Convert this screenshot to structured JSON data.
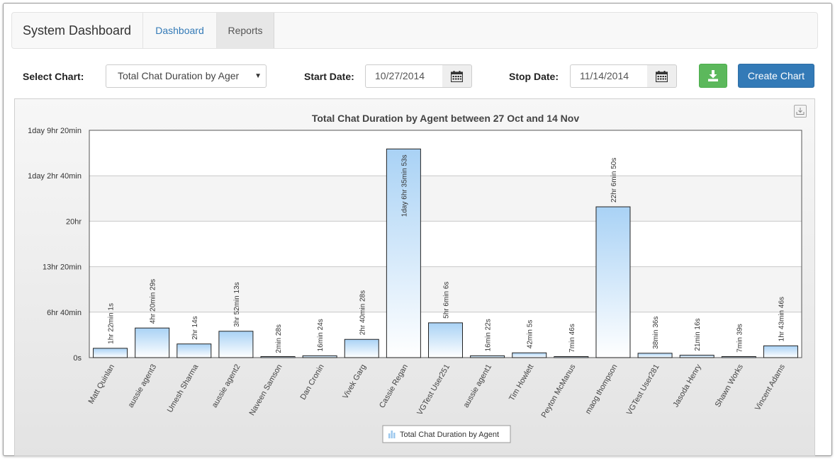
{
  "navbar": {
    "brand": "System Dashboard",
    "tabs": [
      {
        "label": "Dashboard",
        "active": false
      },
      {
        "label": "Reports",
        "active": true
      }
    ]
  },
  "controls": {
    "select_chart_label": "Select Chart:",
    "select_chart_value": "Total Chat Duration by Ager",
    "start_date_label": "Start Date:",
    "start_date_value": "10/27/2014",
    "stop_date_label": "Stop Date:",
    "stop_date_value": "11/14/2014",
    "download_icon": "download-icon",
    "create_chart_label": "Create Chart",
    "calendar_icon": "calendar-icon"
  },
  "colors": {
    "bar_top": "#a9d2f5",
    "bar_bottom": "#ffffff",
    "create_button": "#337ab7",
    "download_button": "#5cb85c",
    "active_tab_text": "#337ab7"
  },
  "chart_data": {
    "type": "bar",
    "title": "Total Chat Duration by Agent between 27 Oct and 14 Nov",
    "legend": {
      "position": "bottom-center",
      "entries": [
        "Total Chat Duration by Agent"
      ]
    },
    "grid": true,
    "y_unit": "seconds",
    "ylim": [
      0,
      120000
    ],
    "y_ticks": [
      {
        "value": 0,
        "label": "0s"
      },
      {
        "value": 24000,
        "label": "6hr 40min"
      },
      {
        "value": 48000,
        "label": "13hr 20min"
      },
      {
        "value": 72000,
        "label": "20hr"
      },
      {
        "value": 96000,
        "label": "1day 2hr 40min"
      },
      {
        "value": 120000,
        "label": "1day 9hr 20min"
      }
    ],
    "categories": [
      "Matt Quinlan",
      "aussie agent3",
      "Umesh Sharma",
      "aussie agent2",
      "Naveen Samson",
      "Dan Cronin",
      "Vivek Garg",
      "Cassie Regan",
      "VGTest User251",
      "aussie agent1",
      "Tim Howlett",
      "Peyton McManus",
      "maog thompson",
      "VGTest User281",
      "Jasoda Henry",
      "Shawn Works",
      "Vincent Adams"
    ],
    "series": [
      {
        "name": "Total Chat Duration by Agent",
        "values": [
          4921,
          15629,
          7214,
          13933,
          148,
          984,
          9628,
          110153,
          18366,
          982,
          2525,
          466,
          79610,
          2316,
          1276,
          459,
          6226
        ],
        "labels": [
          "1hr 22min 1s",
          "4hr 20min 29s",
          "2hr 14s",
          "3hr 52min 13s",
          "2min 28s",
          "16min 24s",
          "2hr 40min 28s",
          "1day 6hr 35min 53s",
          "5hr 6min 6s",
          "16min 22s",
          "42min 5s",
          "7min 46s",
          "22hr 6min 50s",
          "38min 36s",
          "21min 16s",
          "7min 39s",
          "1hr 43min 46s"
        ]
      }
    ]
  }
}
